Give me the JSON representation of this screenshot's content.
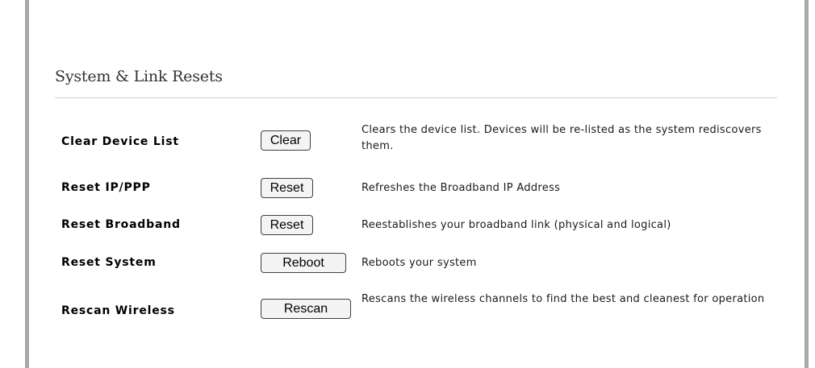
{
  "section": {
    "title": "System & Link Resets"
  },
  "rows": [
    {
      "label": "Clear Device List",
      "button": "Clear",
      "description": "Clears the device list. Devices will be re-listed as the system rediscovers them."
    },
    {
      "label": "Reset IP/PPP",
      "button": "Reset",
      "description": "Refreshes the Broadband IP Address"
    },
    {
      "label": "Reset Broadband",
      "button": "Reset",
      "description": "Reestablishes your broadband link (physical and logical)"
    },
    {
      "label": "Reset System",
      "button": "Reboot",
      "description": "Reboots your system"
    },
    {
      "label": "Rescan Wireless",
      "button": "Rescan",
      "description": "Rescans the wireless channels to find the best and cleanest for operation"
    }
  ]
}
